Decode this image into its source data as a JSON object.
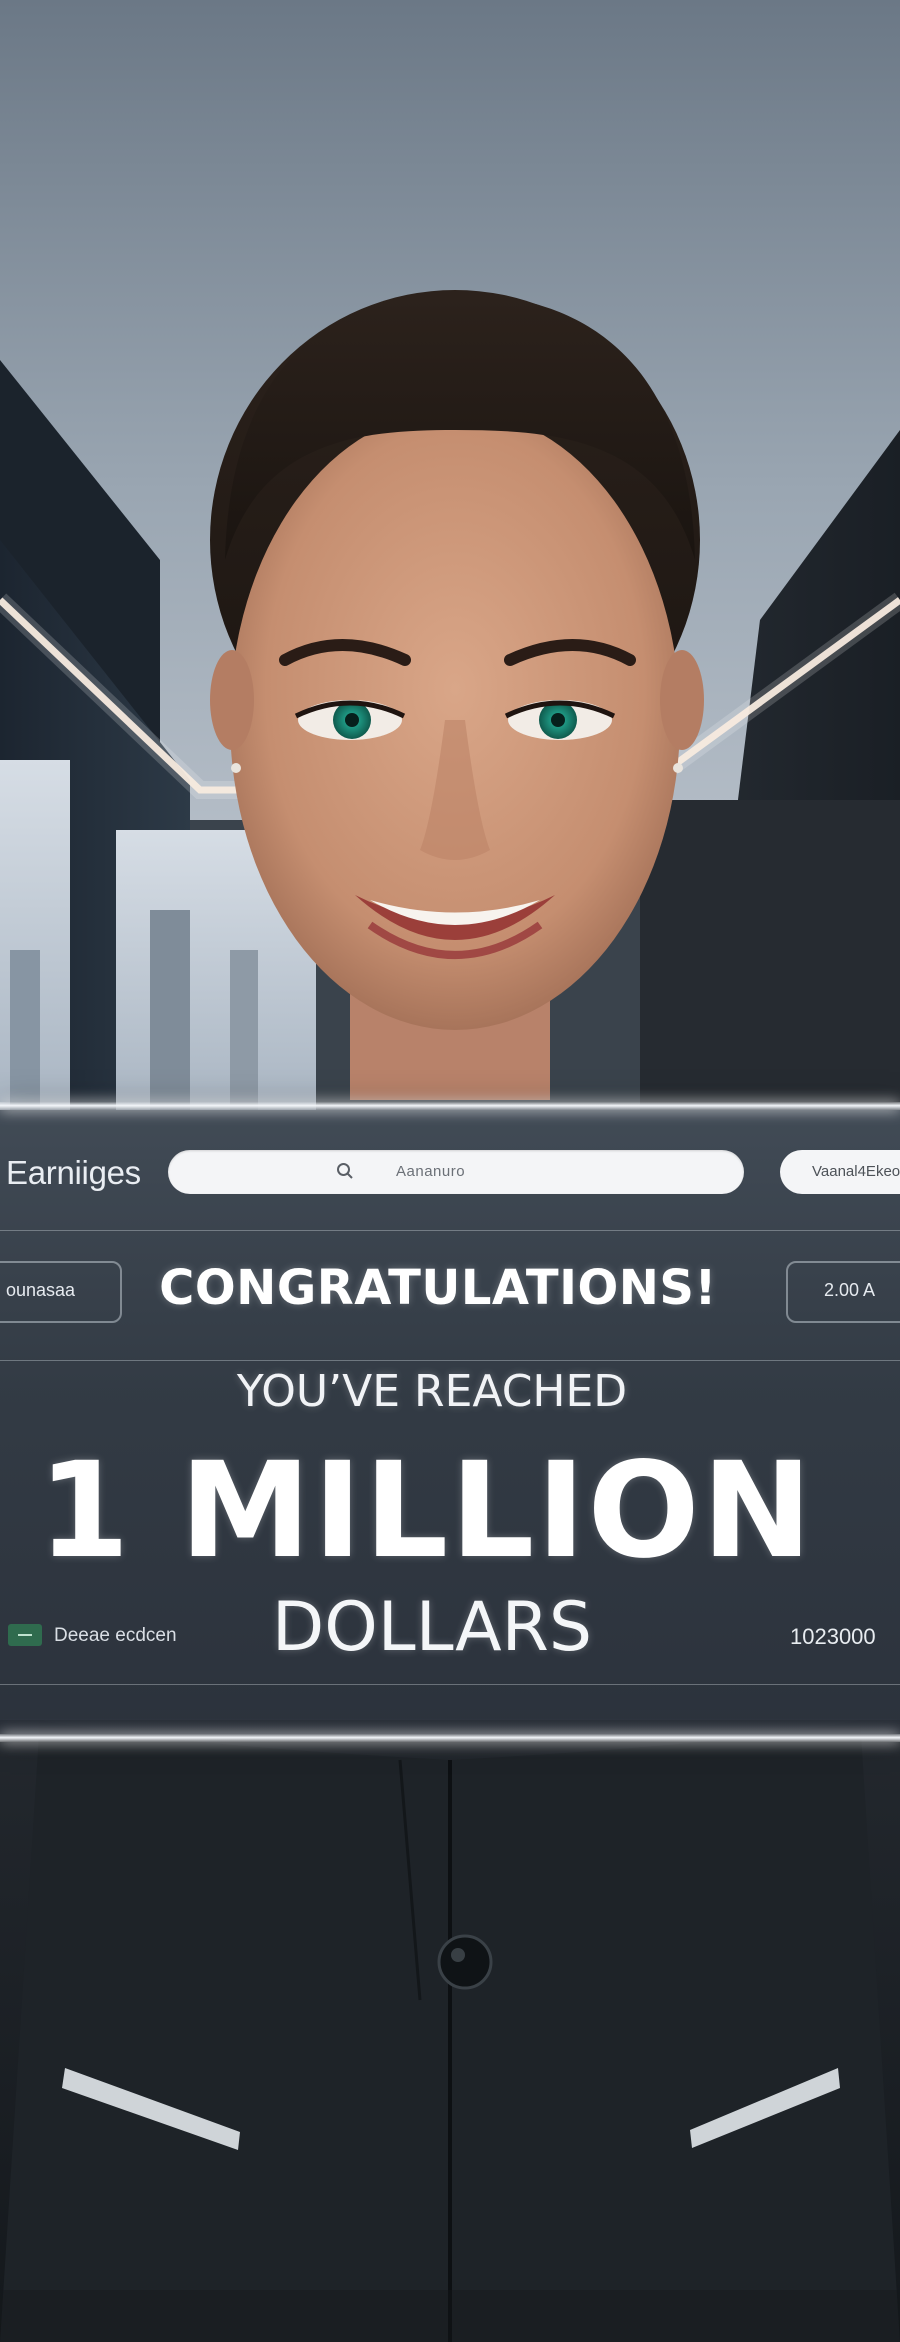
{
  "panel": {
    "brand": "Earniiges",
    "search_placeholder": "Aananuro",
    "top_right_button": "Vaanal4Ekeo",
    "left_box": "ounasaa",
    "right_box": "2.00 A",
    "headline_1": "CONGRATULATIONS!",
    "headline_2": "YOU’VE REACHED",
    "headline_3": "1 MILLION",
    "headline_4": "DOLLARS",
    "bottom_left_label": "Deeae ecdcen",
    "bottom_right_value": "1023000"
  },
  "icons": {
    "search": "search-icon",
    "chip": "money-chip-icon"
  },
  "colors": {
    "panel_glow": "#f3f6fa",
    "chip": "#2f6b4e",
    "eye": "#1f9a85"
  }
}
